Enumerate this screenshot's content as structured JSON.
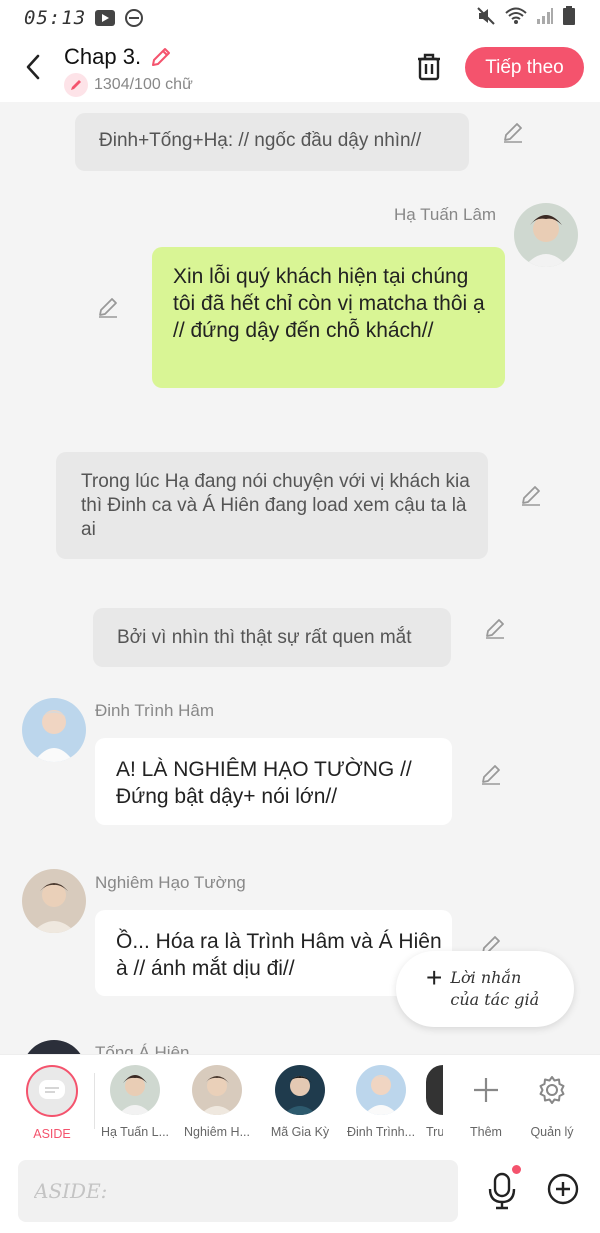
{
  "status": {
    "time": "05:13"
  },
  "header": {
    "title": "Chap 3.",
    "word_count": "1304/100 chữ",
    "next_button": "Tiếp theo"
  },
  "messages": [
    {
      "type": "narration",
      "text": "Đinh+Tống+Hạ: // ngốc đầu dậy nhìn//"
    },
    {
      "type": "right",
      "name": "Hạ Tuấn Lâm",
      "text": "Xin lỗi quý khách hiện tại chúng tôi đã hết chỉ còn vị matcha thôi ạ // đứng dậy đến chỗ khách//"
    },
    {
      "type": "narration",
      "text": "Trong lúc Hạ đang nói chuyện với vị khách kia thì Đinh ca và Á Hiên đang load xem cậu ta là ai"
    },
    {
      "type": "narration",
      "text": "Bởi vì nhìn thì thật sự rất quen mắt"
    },
    {
      "type": "left",
      "name": "Đinh Trình Hâm",
      "text": "A! LÀ NGHIÊM HẠO TƯỜNG // Đứng bật dậy+ nói lớn//"
    },
    {
      "type": "left",
      "name": "Nghiêm Hạo Tường",
      "text": "Ồ... Hóa ra là Trình Hâm và Á Hiên à // ánh mắt dịu đi//"
    },
    {
      "type": "left",
      "name": "Tống Á Hiên",
      "text": ""
    }
  ],
  "author_note": {
    "line1": "Lời nhắn",
    "line2": "của tác giả"
  },
  "characters": [
    {
      "label": "ASIDE"
    },
    {
      "label": "Hạ Tuấn L..."
    },
    {
      "label": "Nghiêm H..."
    },
    {
      "label": "Mã Gia Kỳ"
    },
    {
      "label": "Đinh Trình..."
    },
    {
      "label": "Trươ..."
    },
    {
      "label": "Thêm"
    },
    {
      "label": "Quản lý"
    }
  ],
  "input": {
    "placeholder": "ASIDE:"
  },
  "colors": {
    "accent": "#f4536d",
    "green_bubble": "#d9f595",
    "background": "#f4f4f4"
  }
}
